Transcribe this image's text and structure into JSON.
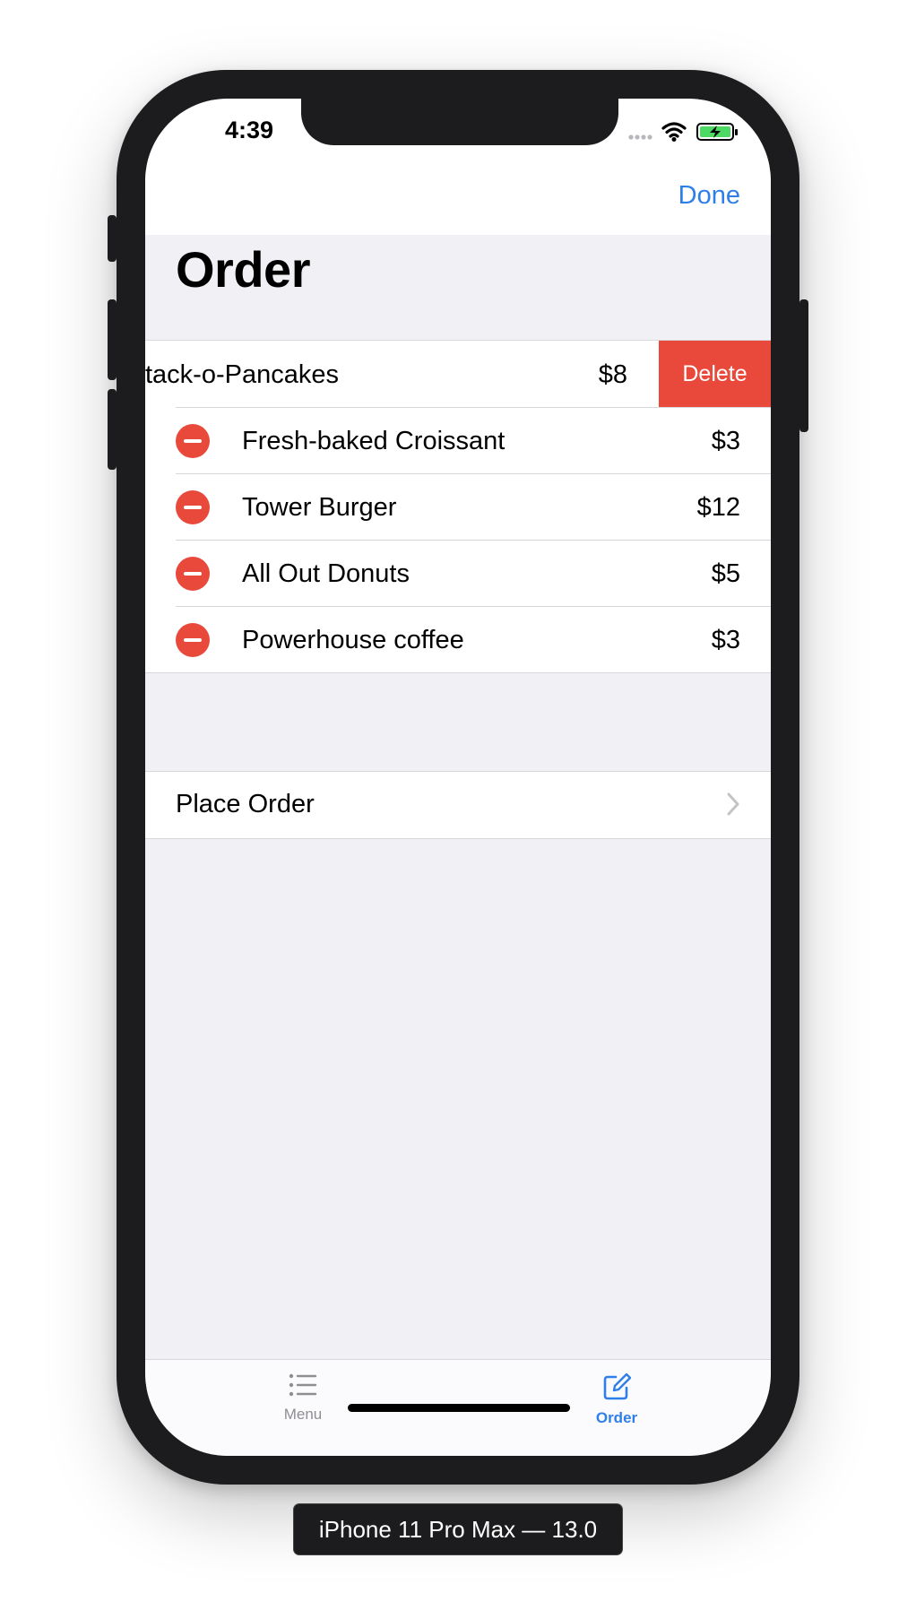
{
  "status_bar": {
    "time": "4:39"
  },
  "nav": {
    "done_label": "Done",
    "title": "Order"
  },
  "order_items": [
    {
      "name": "tack-o-Pancakes",
      "price": "$8",
      "swiped": true
    },
    {
      "name": "Fresh-baked Croissant",
      "price": "$3"
    },
    {
      "name": "Tower Burger",
      "price": "$12"
    },
    {
      "name": "All Out Donuts",
      "price": "$5"
    },
    {
      "name": "Powerhouse coffee",
      "price": "$3"
    }
  ],
  "swipe_action": {
    "delete_label": "Delete"
  },
  "place_order": {
    "label": "Place Order"
  },
  "tabbar": {
    "menu_label": "Menu",
    "order_label": "Order",
    "selected": "Order"
  },
  "device_caption": "iPhone 11 Pro Max — 13.0",
  "colors": {
    "accent": "#2f7fe8",
    "destructive": "#e9493b",
    "background": "#f0f0f5",
    "battery": "#4cd964"
  },
  "icons": {
    "wifi": "wifi-icon",
    "signal": "cellular-signal-icon",
    "battery": "battery-charging-icon",
    "menu": "list-icon",
    "order": "compose-icon",
    "row_delete": "minus-circle-icon",
    "disclosure": "chevron-right-icon"
  }
}
